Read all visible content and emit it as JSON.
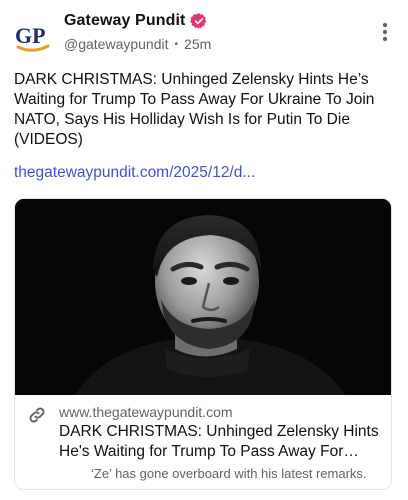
{
  "post": {
    "author_name": "Gateway Pundit",
    "author_handle": "@gatewaypundit",
    "separator": "•",
    "time_ago": "25m",
    "avatar_text": "GP",
    "text": "DARK CHRISTMAS: Unhinged Zelensky Hints He’s Waiting for Trump To Pass Away For Ukraine To Join NATO, Says His Holliday Wish Is for Putin To Die (VIDEOS)",
    "link_text": "thegatewaypundit.com/2025/12/d..."
  },
  "link_card": {
    "domain": "www.thegatewaypundit.com",
    "title": "DARK CHRISTMAS: Unhinged Zelensky Hints He's Waiting for Trump To Pass Away For Ukrai...",
    "description": "‘Ze’ has gone overboard with his latest remarks."
  },
  "icons": {
    "verified": "verified-badge-icon",
    "more": "more-vertical-icon",
    "link": "link-icon"
  },
  "colors": {
    "verified_badge": "#e3366f",
    "link": "#3f51d7",
    "muted_text": "#5f6368",
    "avatar_navy": "#1c2b6b",
    "avatar_gold": "#e7a224"
  }
}
